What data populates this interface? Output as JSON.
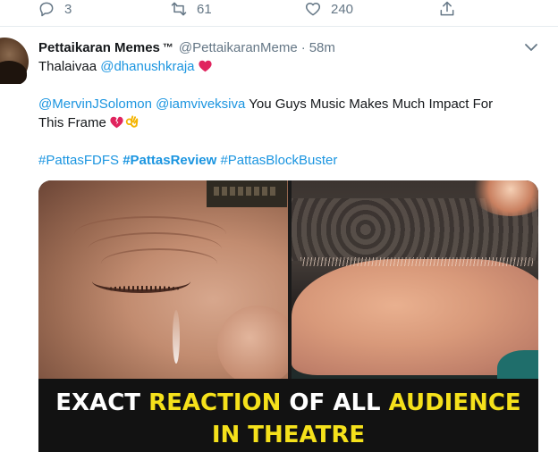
{
  "actions": {
    "reply_count": "3",
    "retweet_count": "61",
    "like_count": "240"
  },
  "tweet": {
    "author_name": "Pettaikaran Memes",
    "author_badge": "™",
    "handle": "@PettaikaranMeme",
    "separator": "·",
    "time": "58m",
    "line1": {
      "text": "Thalaivaa ",
      "mention": "@dhanushkraja"
    },
    "line2": {
      "mention1": "@MervinJSolomon",
      "mention2": "@iamviveksiva",
      "text": " You Guys Music Makes Much Impact For"
    },
    "line3": {
      "text": "This Frame"
    },
    "hashtags": [
      "#PattasFDFS",
      "#PattasReview",
      "#PattasBlockBuster"
    ]
  },
  "media": {
    "caption_line1": [
      {
        "text": "EXACT ",
        "color": "white"
      },
      {
        "text": "REACTION",
        "color": "yellow"
      },
      {
        "text": " OF ALL ",
        "color": "white"
      },
      {
        "text": "AUDIENCE",
        "color": "yellow"
      }
    ],
    "caption_line2": [
      {
        "text": "IN THEATRE",
        "color": "yellow"
      }
    ]
  },
  "colors": {
    "link": "#1b95e0",
    "muted": "#657786",
    "caption_white": "#ffffff",
    "caption_yellow": "#f5e11b",
    "heart": "#e0245e"
  },
  "icons": [
    "reply-icon",
    "retweet-icon",
    "like-icon",
    "share-icon",
    "chevron-down-icon",
    "red-heart-emoji-icon",
    "broken-heart-emoji-icon",
    "ok-hand-emoji-icon"
  ]
}
